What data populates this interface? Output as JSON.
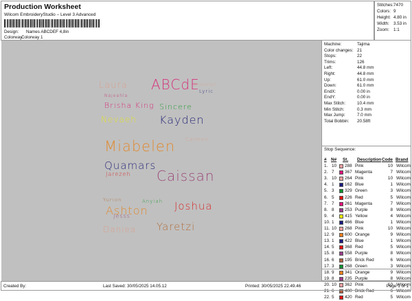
{
  "header": {
    "title": "Production Worksheet",
    "subtitle": "Wilcom EmbroideryStudio – Level 3 Advanced",
    "design_label": "Design:",
    "design_value": "Names ABCDEF 4,8in",
    "colorway_label": "Colorway:",
    "colorway_value": "Colorway 1"
  },
  "stats": [
    {
      "label": "Stitches:",
      "value": "7470"
    },
    {
      "label": "Colors:",
      "value": "9"
    },
    {
      "label": "Height:",
      "value": "4.80 in"
    },
    {
      "label": "Width:",
      "value": "3.53 in"
    },
    {
      "label": "Zoom:",
      "value": "1:1"
    }
  ],
  "design_names": [
    {
      "text": "Laura",
      "color": "#d9a090"
    },
    {
      "text": "ABCdE",
      "color": "#d6327a"
    },
    {
      "text": "Brooklyn",
      "color": "#d9a090"
    },
    {
      "text": "Lyric",
      "color": "#2a2a7a"
    },
    {
      "text": "Najeahla",
      "color": "#c0306a"
    },
    {
      "text": "Brisha King",
      "color": "#d6327a"
    },
    {
      "text": "Sincere",
      "color": "#2a9a3a"
    },
    {
      "text": "Nevaeh",
      "color": "#e0e030"
    },
    {
      "text": "Kayden",
      "color": "#2a2a7a"
    },
    {
      "text": "Carmen",
      "color": "#d9a090"
    },
    {
      "text": "Miabelen",
      "color": "#e08a30"
    },
    {
      "text": "Quamars",
      "color": "#2a2a7a"
    },
    {
      "text": "Jarezeh",
      "color": "#d62a2a"
    },
    {
      "text": "Caissan",
      "color": "#9a4a7a"
    },
    {
      "text": "Yurion",
      "color": "#b07040"
    },
    {
      "text": "Anyiah",
      "color": "#2a9a3a"
    },
    {
      "text": "Ashton",
      "color": "#e08a30"
    },
    {
      "text": "Joshua",
      "color": "#d62a2a"
    },
    {
      "text": "Jesss",
      "color": "#9a4a7a"
    },
    {
      "text": "Daniea",
      "color": "#d9a090"
    },
    {
      "text": "Yaretzi",
      "color": "#b07040"
    }
  ],
  "machine": [
    {
      "label": "Machine:",
      "value": "Tajima"
    },
    {
      "label": "Color changes:",
      "value": "21"
    },
    {
      "label": "Stops:",
      "value": "22"
    },
    {
      "label": "Trims:",
      "value": "126"
    },
    {
      "label": "Left:",
      "value": "44.8 mm"
    },
    {
      "label": "Right:",
      "value": "44.8 mm"
    },
    {
      "label": "Up:",
      "value": "61.0 mm"
    },
    {
      "label": "Down:",
      "value": "61.0 mm"
    },
    {
      "label": "EndX:",
      "value": "0.00 in"
    },
    {
      "label": "EndY:",
      "value": "0.00 in"
    },
    {
      "label": "Max Stitch:",
      "value": "10.4 mm"
    },
    {
      "label": "Min Stitch:",
      "value": "0.3 mm"
    },
    {
      "label": "Max Jump:",
      "value": "7.0 mm"
    },
    {
      "label": "Total Bobbin:",
      "value": "20.58ft"
    }
  ],
  "stop_sequence": {
    "title": "Stop Sequence:",
    "columns": [
      "#",
      "N#",
      "St.",
      "Description",
      "Code",
      "Brand"
    ],
    "rows": [
      {
        "n": "1.",
        "nn": "10",
        "st": "288",
        "desc": "Pink",
        "code": "10",
        "brand": "Wilcom",
        "color": "#f0a0a0"
      },
      {
        "n": "2.",
        "nn": "7",
        "st": "367",
        "desc": "Magenta",
        "code": "7",
        "brand": "Wilcom",
        "color": "#e0107a"
      },
      {
        "n": "3.",
        "nn": "10",
        "st": "264",
        "desc": "Pink",
        "code": "10",
        "brand": "Wilcom",
        "color": "#f0a0a0"
      },
      {
        "n": "4.",
        "nn": "1",
        "st": "162",
        "desc": "Blue",
        "code": "1",
        "brand": "Wilcom",
        "color": "#1a1a80"
      },
      {
        "n": "5.",
        "nn": "3",
        "st": "329",
        "desc": "Green",
        "code": "3",
        "brand": "Wilcom",
        "color": "#109030"
      },
      {
        "n": "6.",
        "nn": "5",
        "st": "226",
        "desc": "Red",
        "code": "5",
        "brand": "Wilcom",
        "color": "#e01010"
      },
      {
        "n": "7.",
        "nn": "7",
        "st": "261",
        "desc": "Magenta",
        "code": "7",
        "brand": "Wilcom",
        "color": "#e0107a"
      },
      {
        "n": "8.",
        "nn": "8",
        "st": "253",
        "desc": "Purple",
        "code": "8",
        "brand": "Wilcom",
        "color": "#9a3a8a"
      },
      {
        "n": "9.",
        "nn": "4",
        "st": "415",
        "desc": "Yellow",
        "code": "4",
        "brand": "Wilcom",
        "color": "#f0f000"
      },
      {
        "n": "10.",
        "nn": "1",
        "st": "466",
        "desc": "Blue",
        "code": "1",
        "brand": "Wilcom",
        "color": "#1a1a80"
      },
      {
        "n": "11.",
        "nn": "10",
        "st": "268",
        "desc": "Pink",
        "code": "10",
        "brand": "Wilcom",
        "color": "#f0a0a0"
      },
      {
        "n": "12.",
        "nn": "9",
        "st": "600",
        "desc": "Orange",
        "code": "9",
        "brand": "Wilcom",
        "color": "#f08020"
      },
      {
        "n": "13.",
        "nn": "1",
        "st": "422",
        "desc": "Blue",
        "code": "1",
        "brand": "Wilcom",
        "color": "#1a1a80"
      },
      {
        "n": "14.",
        "nn": "5",
        "st": "368",
        "desc": "Red",
        "code": "5",
        "brand": "Wilcom",
        "color": "#e01010"
      },
      {
        "n": "15.",
        "nn": "8",
        "st": "558",
        "desc": "Purple",
        "code": "8",
        "brand": "Wilcom",
        "color": "#9a3a8a"
      },
      {
        "n": "16.",
        "nn": "6",
        "st": "195",
        "desc": "Brick Red",
        "code": "6",
        "brand": "Wilcom",
        "color": "#b06040"
      },
      {
        "n": "17.",
        "nn": "3",
        "st": "268",
        "desc": "Green",
        "code": "3",
        "brand": "Wilcom",
        "color": "#109030"
      },
      {
        "n": "18.",
        "nn": "9",
        "st": "341",
        "desc": "Orange",
        "code": "9",
        "brand": "Wilcom",
        "color": "#f08020"
      },
      {
        "n": "19.",
        "nn": "8",
        "st": "235",
        "desc": "Purple",
        "code": "8",
        "brand": "Wilcom",
        "color": "#9a3a8a"
      },
      {
        "n": "20.",
        "nn": "10",
        "st": "362",
        "desc": "Pink",
        "code": "10",
        "brand": "Wilcom",
        "color": "#f0a0a0"
      },
      {
        "n": "21.",
        "nn": "6",
        "st": "400",
        "desc": "Brick Red",
        "code": "6",
        "brand": "Wilcom",
        "color": "#b06040"
      },
      {
        "n": "22.",
        "nn": "5",
        "st": "420",
        "desc": "Red",
        "code": "5",
        "brand": "Wilcom",
        "color": "#e01010"
      }
    ]
  },
  "footer": {
    "created_by": "Created By:",
    "last_saved": "Last Saved: 30/05/2025 14.05.12",
    "printed": "Printed: 30/05/2025 22.49.46",
    "page": "Page 1 of 1"
  }
}
